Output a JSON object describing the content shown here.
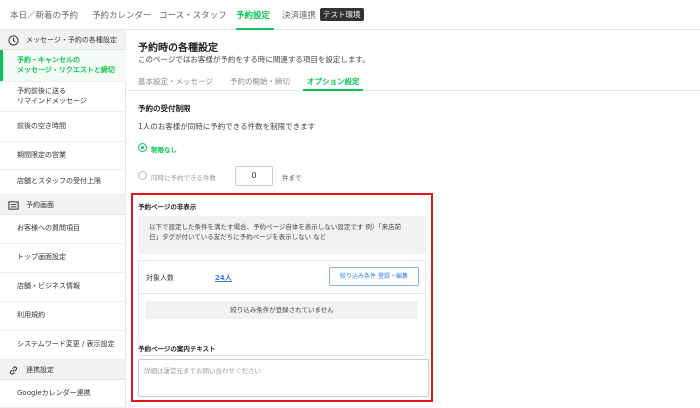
{
  "topnav": {
    "tabs": [
      {
        "label": "本日／新着の予約"
      },
      {
        "label": "予約カレンダー"
      },
      {
        "label": "コース・スタッフ"
      },
      {
        "label": "予約設定"
      },
      {
        "label": "決済連携"
      }
    ],
    "active_tab": "予約設定",
    "badge": "テスト環境"
  },
  "sidebar": {
    "section1": "メッセージ・予約の各種設定",
    "items1": [
      {
        "line1": "予約・キャンセルの",
        "line2": "メッセージ・リクエストと締切"
      },
      {
        "line1": "予約前後に送る",
        "line2": "リマインドメッセージ"
      },
      {
        "line1": "前後の空き時間"
      },
      {
        "line1": "期間限定の営業"
      },
      {
        "line1": "店舗とスタッフの受付上限"
      }
    ],
    "section2": "予約画面",
    "items2": [
      {
        "line1": "お客様への質問項目"
      },
      {
        "line1": "トップ画面設定"
      },
      {
        "line1": "店舗・ビジネス情報"
      },
      {
        "line1": "利用規約"
      },
      {
        "line1": "システムワード変更 / 表示設定"
      }
    ],
    "section3": "連携設定",
    "items3": [
      {
        "line1": "Googleカレンダー連携"
      }
    ]
  },
  "main": {
    "title": "予約時の各種設定",
    "description": "このページではお客様が予約をする時に関連する項目を設定します。",
    "subtabs": [
      {
        "label": "基本設定・メッセージ"
      },
      {
        "label": "予約の開始・締切"
      },
      {
        "label": "オプション設定"
      }
    ],
    "active_subtab": "オプション設定",
    "limit": {
      "title": "予約の受付制限",
      "description": "1人のお客様が同時に予約できる件数を制限できます",
      "option_none": "制限なし",
      "option_count": "同時に予約できる件数",
      "selected": "制限なし",
      "count_value": "0",
      "count_unit": "件まで"
    },
    "hide": {
      "title": "予約ページの非表示",
      "info_line1": "以下で設定した条件を満たす場合、予約ページ自体を表示しない設定です 例）「来店前",
      "info_line2": "日」タグが付いている友だちに予約ページを表示しない など",
      "target_label": "対象人数",
      "target_count": "24人",
      "filter_button": "絞り込み条件 登録・編集",
      "empty_message": "絞り込み条件が登録されていません",
      "guide_title": "予約ページの案内テキスト",
      "guide_placeholder": "詳細は運営元までお問い合わせください"
    }
  },
  "colors": {
    "accent": "#06c755",
    "link": "#2f7be5",
    "highlight_border": "#e0151b"
  }
}
